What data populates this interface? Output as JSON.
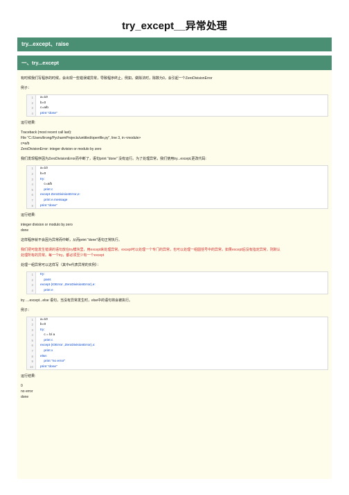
{
  "page": {
    "title": "try_except__异常处理",
    "banner1": "try...except、raise",
    "banner2": "一、try...except"
  },
  "body": {
    "intro": "有时候我们写程序的时候，会出现一些错误或异常，导致程序终止。例如，做除法时，除数为0，会引起一个ZeroDivisionError",
    "example_label1": "例子：",
    "run_result1": "运行结果:",
    "traceback": [
      "Traceback (most recent call last):",
      "File \"C:/Users/lirong/PycharmProjects/untitled/openfile.py\", line 3, in <module>",
      "c=a/b",
      "ZeroDivisionError: integer division or modulo by zero"
    ],
    "found_text": "我们发现程序因为ZeroDivisionError而中断了，语句print \"done\" 没有运行。为了处理异常，我们使用try...except,更改代码:",
    "run_result2": "运行结果:",
    "output2": [
      "integer division or modulo by zero",
      "done"
    ],
    "no_interrupt": "这样程序就不会因为异常而中断，从而print \"done\"语句正常执行。",
    "red_text": [
      "我们把可能发生错误的语句放在try模块里，用except来处理异常。except可以处理一个专门的异常，也可以处理一组圆括号中的异常，如果except后没有指定异常，则默认",
      "处理所有的异常。每一个try，都必须至少有一个except"
    ],
    "group_text": "处理一组异常可以这样写（其中e代表异常的实例）：",
    "else_text": "try ....except...else 语句，当没有异常发生时，else中的语句将会被执行。",
    "example_label2": "例子：",
    "run_result3": "运行结果:",
    "output3": [
      "0",
      "no error",
      "done"
    ]
  },
  "code_blocks": [
    {
      "line_numbers": [
        "1",
        "2",
        "3",
        "4"
      ],
      "lines": [
        "a=10",
        "b=0",
        "c=a/b",
        "print \"done\""
      ]
    },
    {
      "line_numbers": [
        "1",
        "2",
        "3",
        "4",
        "5",
        "6",
        "7",
        "8"
      ],
      "lines": [
        "a=10",
        "b=0",
        "try:",
        "    c=a/b",
        "    print c",
        "except ZeroDivisionError,e:",
        "    print e.message",
        "print \"done\""
      ]
    },
    {
      "line_numbers": [
        "1",
        "2",
        "3",
        "4"
      ],
      "lines": [
        "try:",
        "    pass",
        "except (IOError ,ZeroDivisionError),e:",
        "    print e"
      ]
    },
    {
      "line_numbers": [
        "1",
        "2",
        "3",
        "4",
        "5",
        "6",
        "7",
        "8",
        "9",
        "10"
      ],
      "lines": [
        "a=10",
        "b=0",
        "try:",
        "    c = b/ a",
        "    print c",
        "except (IOError ,ZeroDivisionError),x:",
        "    print x",
        "else:",
        "    print \"no error\"",
        "print \"done\""
      ]
    }
  ],
  "colors": {
    "banner": "#4a8f73",
    "content_bg": "#fefcea",
    "emphasis": "#d32f2f"
  }
}
